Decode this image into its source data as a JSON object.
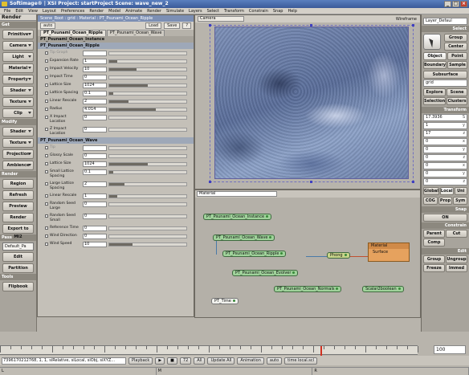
{
  "window": {
    "title": "Softimage® | XSI Project: startProject   Scene: wave_new_2",
    "controls": [
      "_",
      "□",
      "×"
    ]
  },
  "menu": [
    "File",
    "Edit",
    "View",
    "Layout",
    "Preferences",
    "Render",
    "Model",
    "Animate",
    "Render",
    "Simulate",
    "Layers",
    "Select",
    "Transform",
    "Constrain",
    "Snap",
    "Help"
  ],
  "left_toolbar": {
    "header": "Render",
    "get_section": "Get",
    "get_buttons": [
      "Primitive",
      "Camera",
      "Light",
      "Material",
      "Property",
      "Shader",
      "Texture",
      "Clip"
    ],
    "modify_section": "Modify",
    "modify_buttons": [
      "Shader",
      "Texture",
      "Projection",
      "Ambience"
    ],
    "render_section": "Render",
    "render_buttons": [
      "Region",
      "Refresh",
      "Preview",
      "Render",
      "Export to MI2"
    ],
    "pass_section": "Pass",
    "pass_value": "Default_Pa",
    "pass_buttons": [
      "Edit",
      "Partition"
    ],
    "tools_section": "Tools",
    "tools_buttons": [
      "Flipbook"
    ]
  },
  "property_panel": {
    "path": "Scene_Root : grid : Material : PT_Psunami_Ocean_Ripple",
    "preset": "auto",
    "load": "Load",
    "save": "Save",
    "help": "?",
    "tabs": [
      "PT_Psunami_Ocean_Ripple",
      "PT_Psunami_Ocean_Wave"
    ],
    "instance_tab": "PT_Psunami_Ocean_Instance",
    "ripple_group": "PT_Psunami_Ocean_Ripple",
    "ripple_rows": [
      {
        "label": "Tip Graph",
        "value": "",
        "fill": 0,
        "dim": true
      },
      {
        "label": "Expansion Rate",
        "value": "1",
        "fill": 0.1
      },
      {
        "label": "Impact Velocity",
        "value": "10",
        "fill": 0.35
      },
      {
        "label": "Impact Time",
        "value": "0",
        "fill": 0
      },
      {
        "label": "Lattice Size",
        "value": "1024",
        "fill": 0.5
      },
      {
        "label": "Lattice Spacing",
        "value": "0.1",
        "fill": 0.05
      },
      {
        "label": "Linear Rescale",
        "value": "2",
        "fill": 0.25
      },
      {
        "label": "Radius",
        "value": "4.014",
        "fill": 0.6
      },
      {
        "label": "X Impact Location",
        "value": "0",
        "fill": 0,
        "tall": true
      },
      {
        "label": "Z Impact Location",
        "value": "0",
        "fill": 0,
        "tall": true
      }
    ],
    "wave_group": "PT_Psunami_Ocean_Wave",
    "wave_rows": [
      {
        "label": "Tip",
        "value": "",
        "fill": 0,
        "dim": true
      },
      {
        "label": "Glossy Scale",
        "value": "0",
        "fill": 0
      },
      {
        "label": "Lattice Size",
        "value": "1024",
        "fill": 0.5
      },
      {
        "label": "Small Lattice Spacing",
        "value": "0.1",
        "fill": 0.05,
        "tall": true
      },
      {
        "label": "Large Lattice Spacing",
        "value": "2",
        "fill": 0.2,
        "tall": true
      },
      {
        "label": "Linear Rescale",
        "value": "1",
        "fill": 0.1
      },
      {
        "label": "Random Seed Large",
        "value": "0",
        "fill": 0,
        "tall": true
      },
      {
        "label": "Random Seed Small",
        "value": "0",
        "fill": 0,
        "tall": true
      },
      {
        "label": "Reference Time",
        "value": "0",
        "fill": 0
      },
      {
        "label": "Wind Direction",
        "value": "0",
        "fill": 0
      },
      {
        "label": "Wind Speed",
        "value": "10",
        "fill": 0.3
      }
    ]
  },
  "viewport": {
    "camera": "Camera",
    "display_mode": "Wireframe"
  },
  "render_tree": {
    "combo": "Material",
    "nodes": [
      {
        "label": "PT_Psunami_Ocean_Instance"
      },
      {
        "label": "PT_Psunami_Ocean_Wave"
      },
      {
        "label": "PT_Psunami_Ocean_Ripple"
      },
      {
        "label": "PT_Psunami_Ocean_Evolver"
      },
      {
        "label": "PT_Psunami_Ocean_Normals"
      },
      {
        "label": "Scalar2boolean"
      },
      {
        "label": "PT_Time"
      },
      {
        "label": "Phong"
      }
    ],
    "material_node": {
      "title": "Material",
      "port": "Surface"
    }
  },
  "right_panel": {
    "layer": "Layer_Defaul",
    "select_section": "Select",
    "select_buttons": [
      "Group",
      "Center"
    ],
    "filter_buttons": [
      "Object",
      "Point",
      "Boundary",
      "Sample"
    ],
    "subsurface": "Subsurface",
    "search_value": "grid",
    "explore_buttons": [
      "Explore",
      "Scene",
      "Selection",
      "Clusters"
    ],
    "transform_section": "Transform",
    "fields": [
      {
        "value": "17.3936",
        "axis": "S"
      },
      {
        "value": "1",
        "axis": "y"
      },
      {
        "value": "17",
        "axis": "z"
      },
      {
        "value": "0",
        "axis": "x"
      },
      {
        "value": "0",
        "axis": "y"
      },
      {
        "value": "0",
        "axis": "z"
      },
      {
        "value": "0",
        "axis": "x"
      },
      {
        "value": "0",
        "axis": "y"
      },
      {
        "value": "0",
        "axis": "z"
      }
    ],
    "ref_buttons": [
      "Global",
      "Local",
      "Uni"
    ],
    "cog_buttons": [
      "COG",
      "Prop",
      "Sym"
    ],
    "snap_section": "Snap",
    "snap_value": "ON",
    "constrain_section": "Constrain",
    "constrain_buttons": [
      "Parent",
      "Cut",
      "Comp"
    ],
    "edit_section": "Edit",
    "edit_buttons": [
      "Group",
      "Ungroup",
      "Freeze",
      "Immed"
    ]
  },
  "timeline": {
    "start": "1",
    "end": "100",
    "current_frame": "72"
  },
  "playback": {
    "label": "Playback",
    "frame": "72",
    "all": "All",
    "update_all": "Update All",
    "animation": "Animation",
    "auto": "auto",
    "time_mode": "time local.scl"
  },
  "command_line": {
    "value": "7396170212768, 1, 1, siRelative, siLocal, siObj, siXYZ..."
  },
  "status": {
    "left": "L",
    "mid": "M",
    "right": "R"
  }
}
